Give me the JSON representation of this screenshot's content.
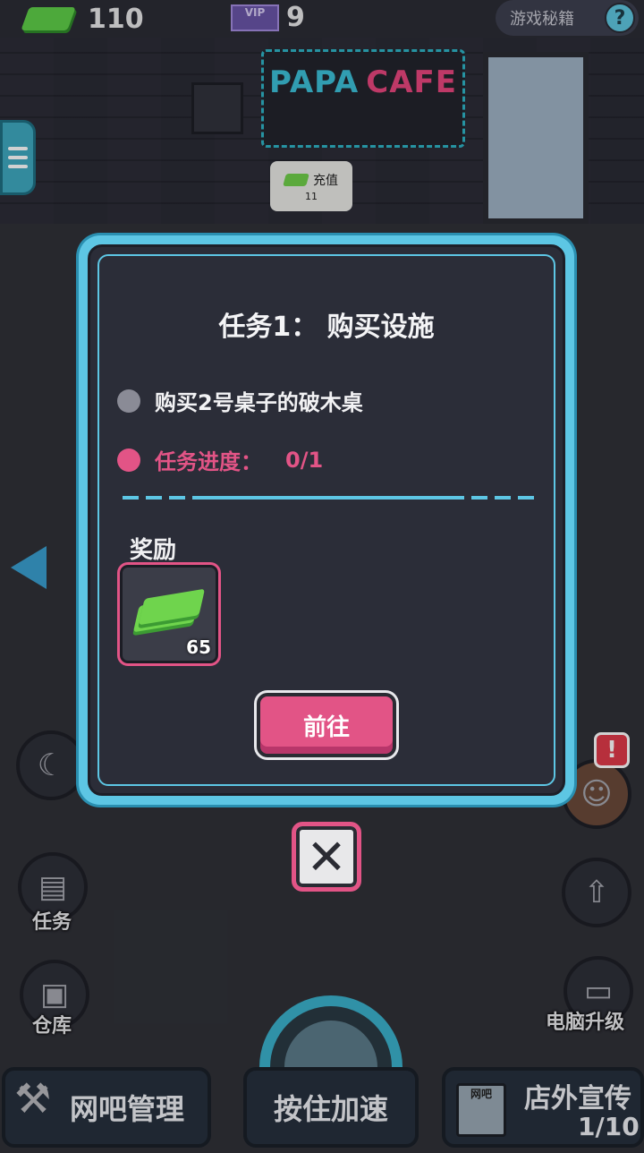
{
  "topbar": {
    "cash_value": "110",
    "vip_value": "9",
    "vip_label": "VIP",
    "secret_label": "游戏秘籍",
    "help_glyph": "?"
  },
  "scene": {
    "sign_papa": "PAPA",
    "sign_cafe": "CAFE",
    "recharge_label": "充值",
    "recharge_count": "11"
  },
  "modal": {
    "title": "任务1： 购买设施",
    "task_desc": "购买2号桌子的破木桌",
    "progress_label": "任务进度：",
    "progress_value": "0/1",
    "reward_label": "奖励",
    "reward_count": "65",
    "goto_label": "前往",
    "close_glyph": "✕"
  },
  "side": {
    "task_label": "任务",
    "warehouse_label": "仓库",
    "pc_upgrade_label": "电脑升级",
    "alert_glyph": "!"
  },
  "bottom": {
    "manage_label": "网吧管理",
    "speedup_label": "按住加速",
    "promo_label": "店外宣传",
    "promo_count": "1/10",
    "promo_shop_label": "网吧"
  },
  "colors": {
    "accent_cyan": "#5dc6e4",
    "accent_pink": "#e25486",
    "panel_dark": "#2b2d38",
    "cash_green": "#6fd44d"
  },
  "icons": [
    "cash-icon",
    "vip-icon",
    "help-icon",
    "menu-icon",
    "left-arrow-icon",
    "moon-icon",
    "task-icon",
    "warehouse-icon",
    "avatar-icon",
    "pc-upgrade-icon",
    "hammer-icon",
    "shop-icon",
    "close-icon"
  ]
}
